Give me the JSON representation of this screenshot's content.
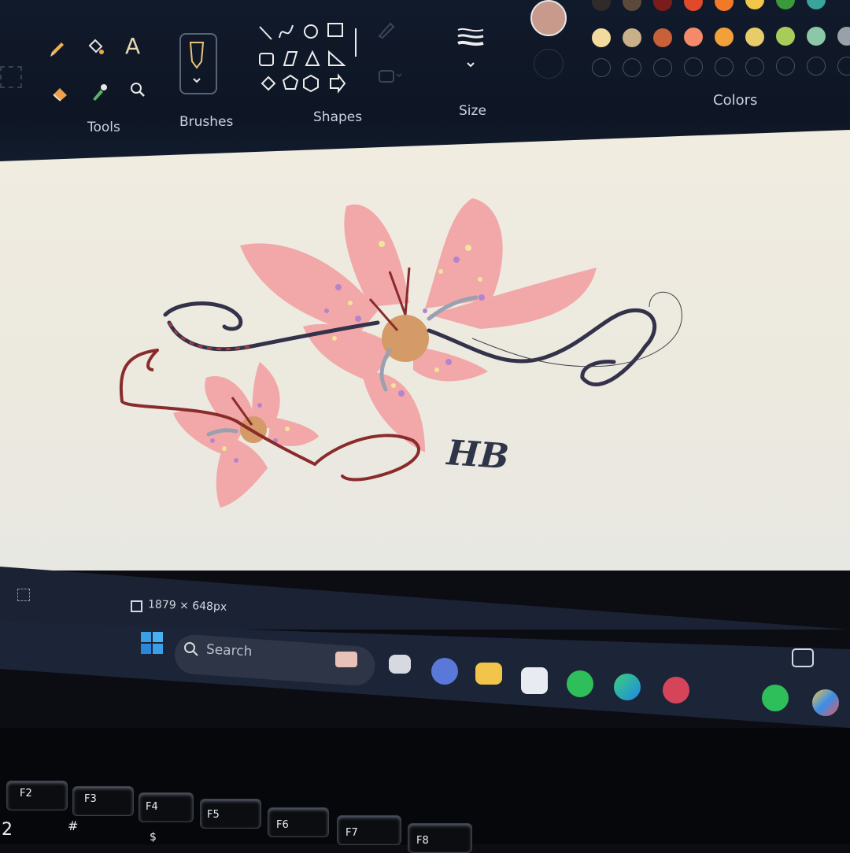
{
  "ribbon": {
    "groups": {
      "tools": "Tools",
      "brushes": "Brushes",
      "shapes": "Shapes",
      "size": "Size",
      "colors": "Colors"
    },
    "colors": {
      "selected": "#c89a8b",
      "row1": [
        "#2f2b2a",
        "#5b4a3a",
        "#7a1c1c",
        "#e04a2a",
        "#f07a2a",
        "#f2c64a",
        "#3a9a3a",
        "#3aa39a"
      ],
      "row2": [
        "#f3dba0",
        "#c8b08a",
        "#c8603a",
        "#f48a6a",
        "#f2a03a",
        "#e8cc6a",
        "#a8cc5a",
        "#8ac8a8",
        "#9aa0a8"
      ]
    }
  },
  "canvas": {
    "signature": "HB",
    "colors": {
      "petal": "#f2a7a8",
      "center": "#d49a68",
      "vine": "#34324a",
      "vine_red": "#8a2b2b",
      "dot_purple": "#b583cf",
      "dot_yellow": "#f2e49a"
    }
  },
  "statusbar": {
    "dimensions": "1879 × 648px"
  },
  "taskbar": {
    "search_placeholder": "Search"
  },
  "keyboard": {
    "keys": [
      "F2",
      "F3",
      "F4",
      "F5",
      "F6",
      "F7",
      "F8"
    ],
    "row2": [
      "2",
      "#",
      "$"
    ]
  }
}
